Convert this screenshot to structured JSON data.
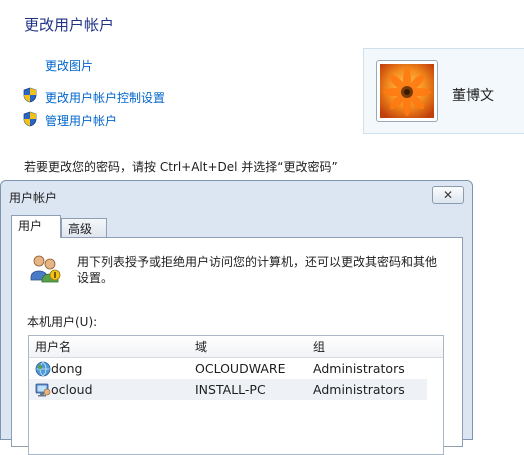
{
  "control_panel": {
    "title": "更改用户帐户",
    "links": {
      "change_picture": "更改图片",
      "uac_settings": "更改用户帐户控制设置",
      "manage_accounts": "管理用户帐户"
    },
    "current_user": {
      "name": "董博文"
    },
    "password_hint": "若要更改您的密码，请按 Ctrl+Alt+Del 并选择“更改密码”"
  },
  "dialog": {
    "title": "用户帐户",
    "tabs": [
      {
        "label": "用户",
        "active": true
      },
      {
        "label": "高级",
        "active": false
      }
    ],
    "description": "用下列表授予或拒绝用户访问您的计算机，还可以更改其密码和其他设置。",
    "local_users_label": "本机用户(U):",
    "columns": {
      "username": "用户名",
      "domain": "域",
      "group": "组"
    },
    "users": [
      {
        "username": "dong",
        "domain": "OCLOUDWARE",
        "group": "Administrators",
        "icon": "domain-user-icon"
      },
      {
        "username": "ocloud",
        "domain": "INSTALL-PC",
        "group": "Administrators",
        "icon": "local-user-icon"
      }
    ]
  },
  "colors": {
    "title_blue": "#1e3287",
    "link_blue": "#0066cc",
    "dialog_frame": "#dbe6f2"
  }
}
